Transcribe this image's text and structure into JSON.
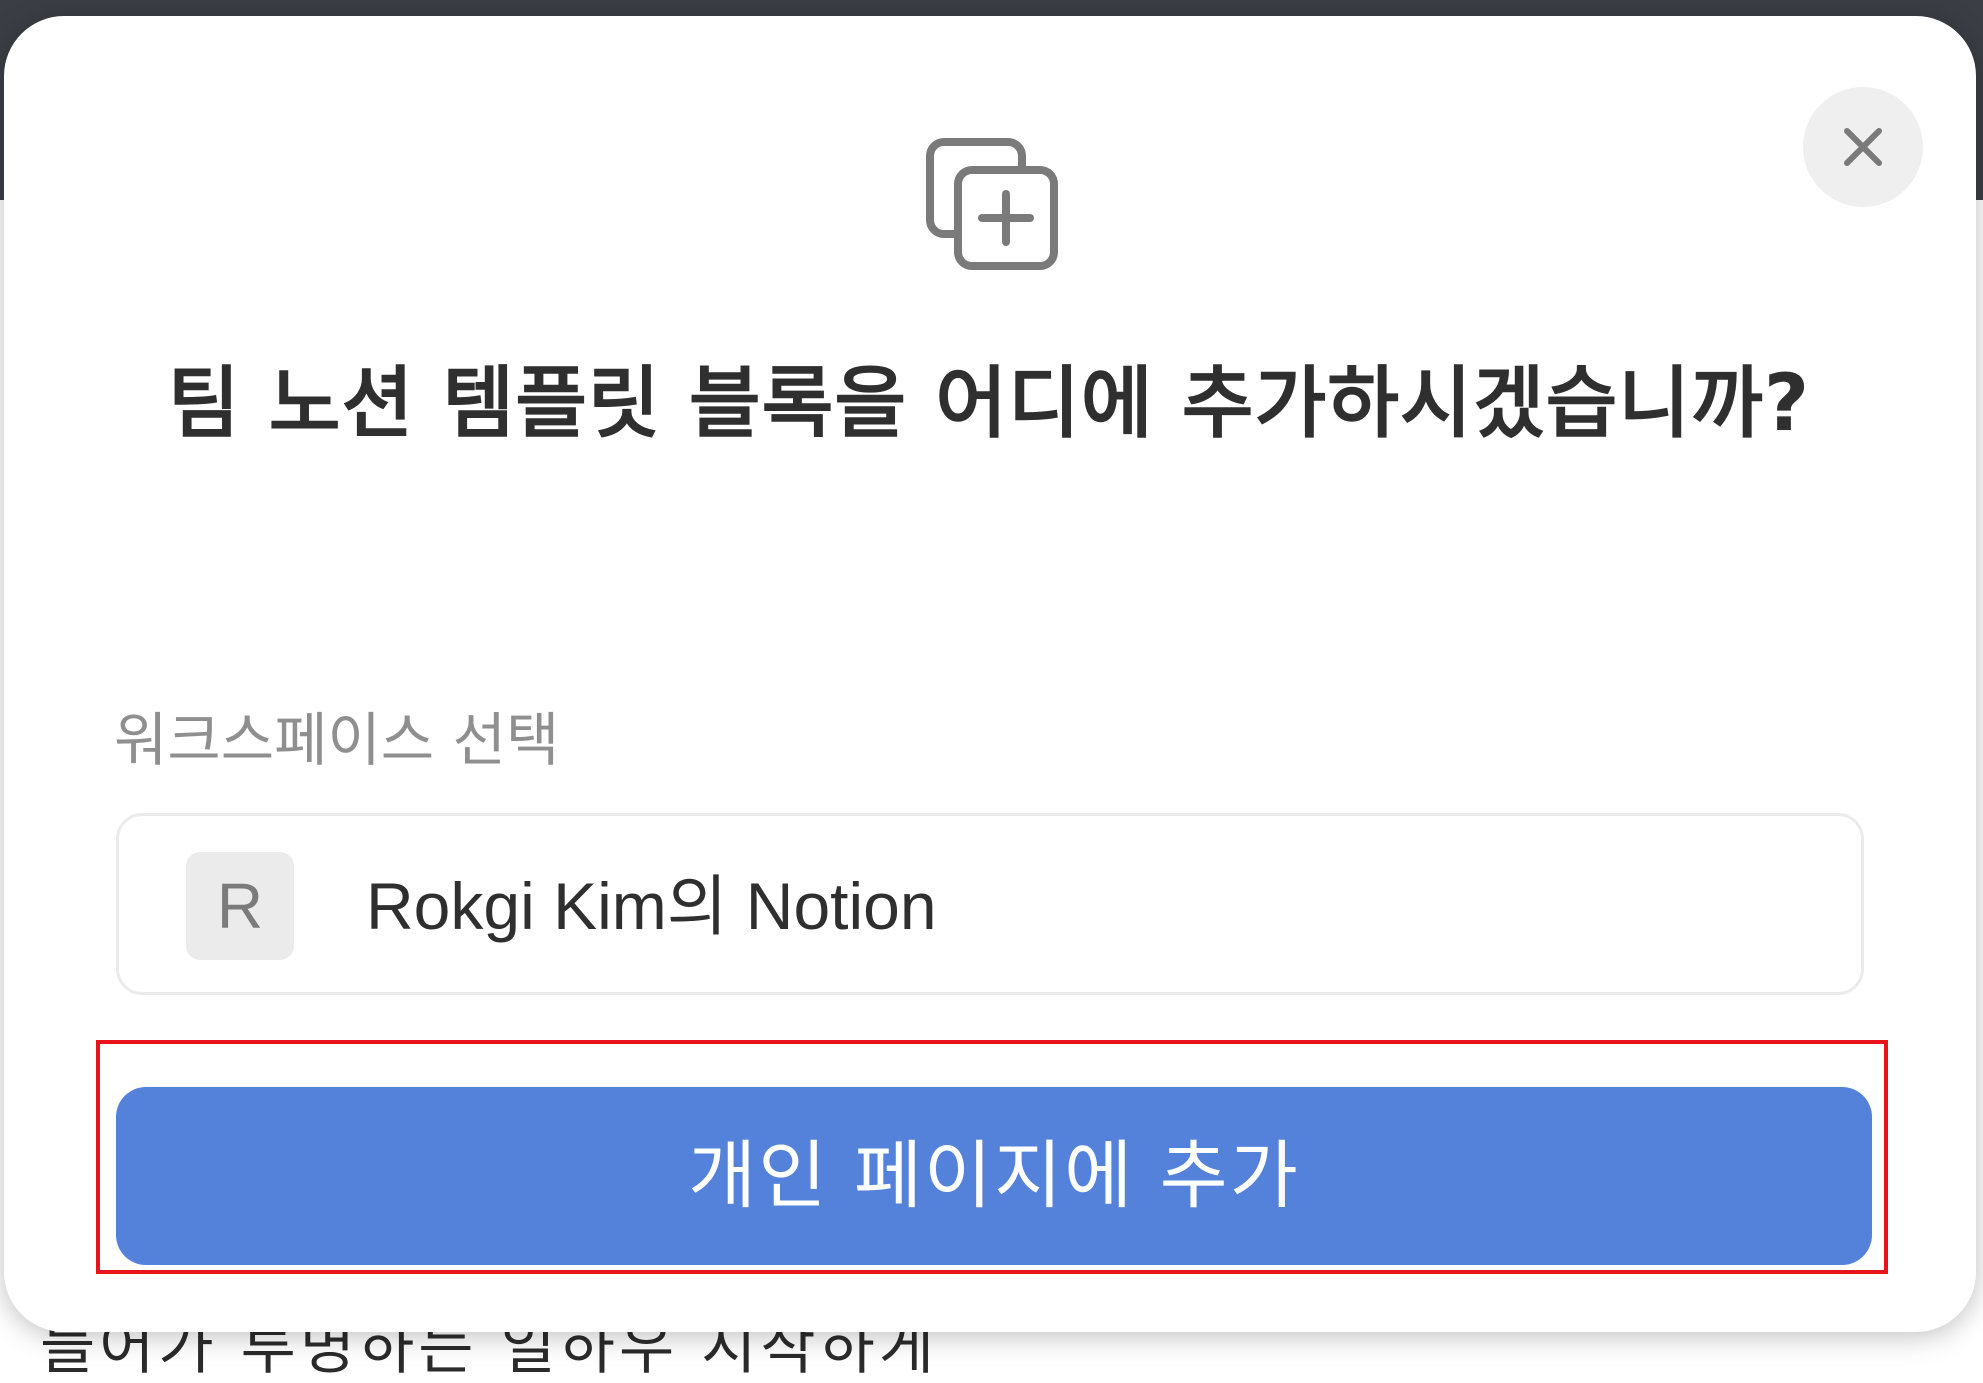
{
  "dialog": {
    "title": "팀 노션 템플릿 블록을 어디에 추가하시겠습니까?",
    "header_icon": "duplicate-add-icon",
    "close_icon": "close-icon",
    "workspace_label": "워크스페이스 선택",
    "workspace": {
      "avatar_letter": "R",
      "name": "Rokgi Kim의 Notion"
    },
    "add_button_label": "개인 페이지에 추가"
  },
  "background_text": "들어가 투명하는 일하우 시작하게",
  "colors": {
    "accent": "#5482db",
    "highlight": "#e8131b",
    "title": "#2f2f2f",
    "muted": "#8f8f8f"
  }
}
